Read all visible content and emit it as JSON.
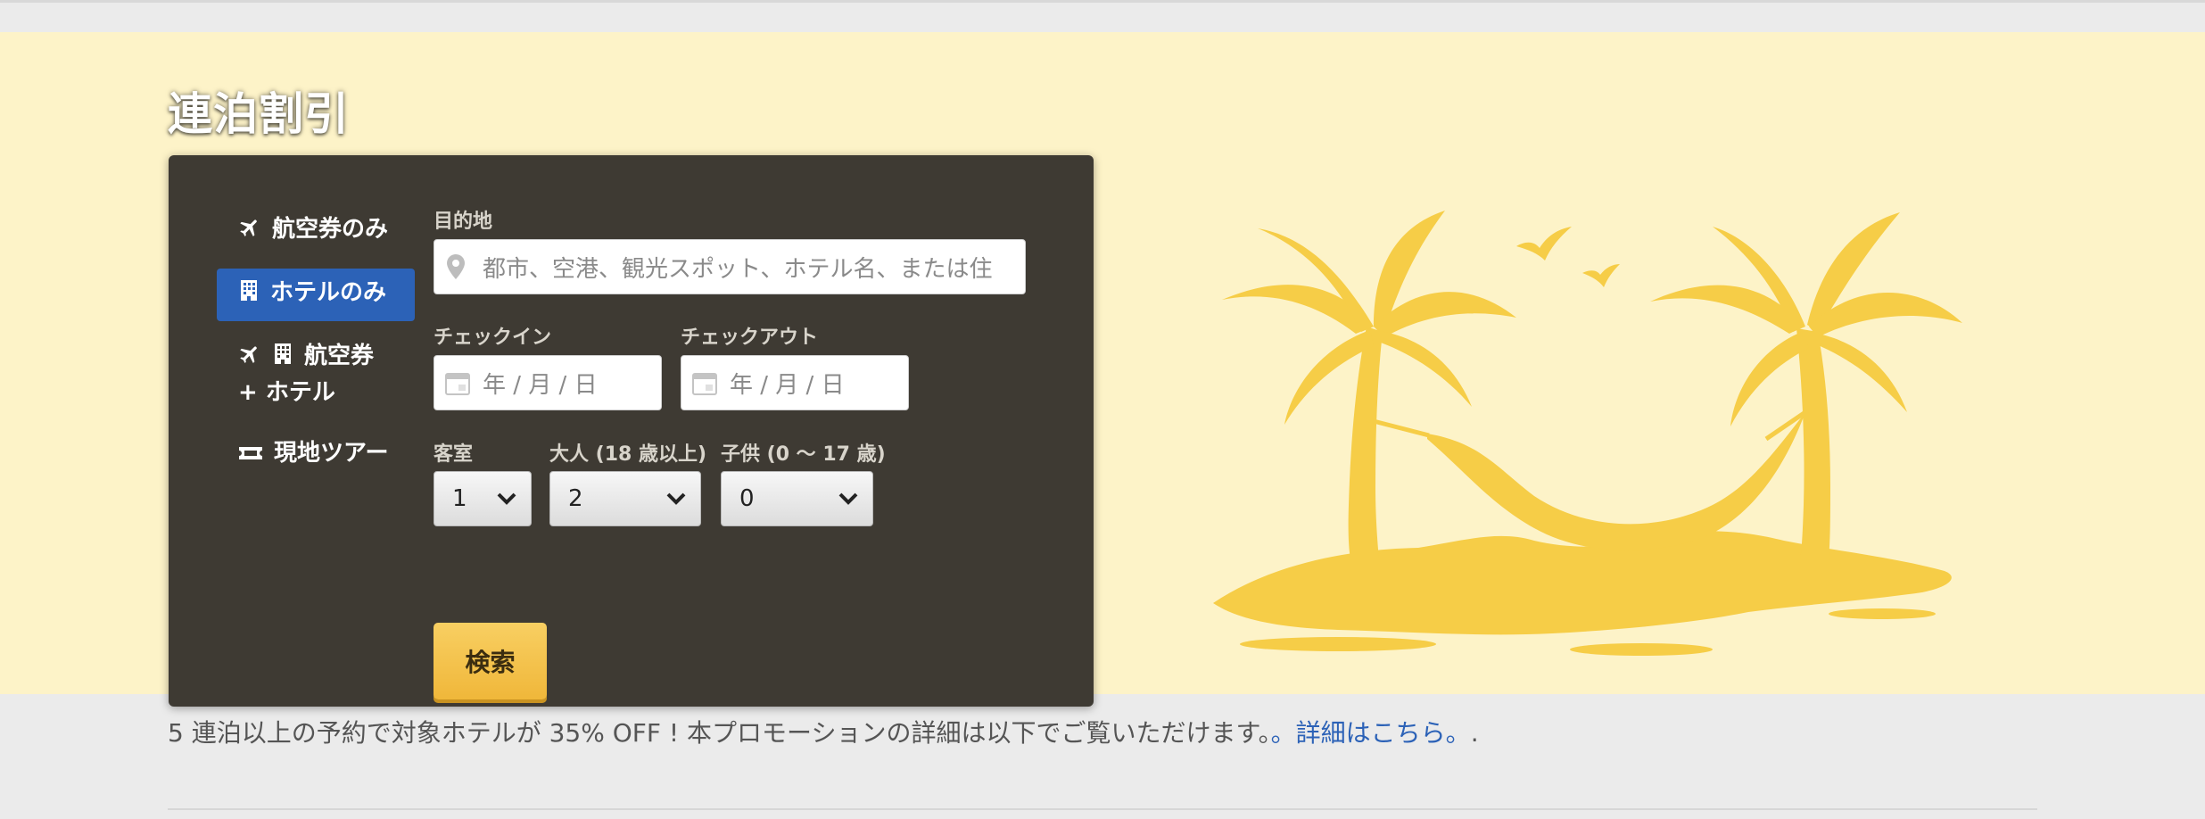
{
  "hero": {
    "title": "連泊割引"
  },
  "nav": {
    "items": [
      {
        "label": "航空券のみ",
        "icons": [
          "plane-icon"
        ],
        "active": false
      },
      {
        "label": "ホテルのみ",
        "icons": [
          "hotel-icon"
        ],
        "active": true
      },
      {
        "label": "航空券 + ホテル",
        "icons": [
          "plane-icon",
          "hotel-icon"
        ],
        "active": false
      },
      {
        "label": "現地ツアー",
        "icons": [
          "ticket-icon"
        ],
        "active": false
      }
    ]
  },
  "form": {
    "destination": {
      "label": "目的地",
      "placeholder": "都市、空港、観光スポット、ホテル名、または住"
    },
    "checkin": {
      "label": "チェックイン",
      "placeholder": "年 / 月 / 日"
    },
    "checkout": {
      "label": "チェックアウト",
      "placeholder": "年 / 月 / 日"
    },
    "rooms": {
      "label": "客室",
      "value": "1"
    },
    "adults": {
      "label": "大人 (18 歳以上)",
      "value": "2"
    },
    "children": {
      "label": "子供 (0 〜 17 歳)",
      "value": "0"
    },
    "search_label": "検索"
  },
  "promo": {
    "text": "5 連泊以上の予約で対象ホテルが 35% OFF ! 本プロモーションの詳細は以下でご覧いただけます。",
    "link_text": "。詳細はこちら。",
    "suffix": "."
  },
  "colors": {
    "accent": "#2c62b7",
    "panel": "#3e3a33",
    "hero_bg": "#fdf3c8",
    "art": "#f6cd47",
    "button": "#f3c24b"
  }
}
